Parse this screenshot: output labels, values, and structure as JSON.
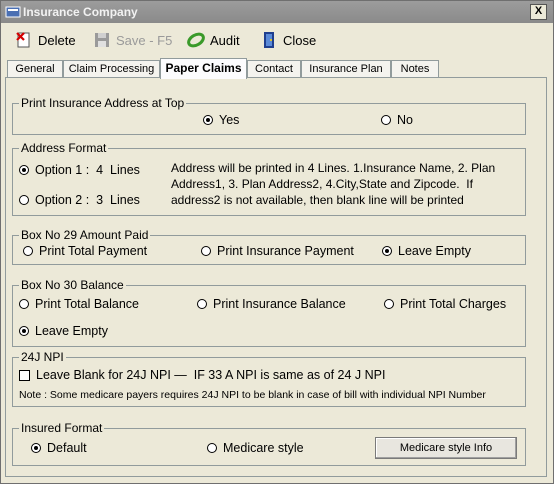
{
  "window": {
    "title": "Insurance Company",
    "close_glyph": "X"
  },
  "toolbar": {
    "delete_label": "Delete",
    "save_label": "Save - F5",
    "audit_label": "Audit",
    "close_label": "Close"
  },
  "tabs": [
    {
      "label": "General"
    },
    {
      "label": "Claim Processing"
    },
    {
      "label": "Paper Claims"
    },
    {
      "label": "Contact"
    },
    {
      "label": "Insurance Plan"
    },
    {
      "label": "Notes"
    }
  ],
  "print_address": {
    "title": "Print Insurance Address at Top",
    "yes": "Yes",
    "no": "No"
  },
  "address_format": {
    "title": "Address Format",
    "option1": "Option 1 :  4  Lines",
    "option2": "Option 2 :  3  Lines",
    "description_line1": "Address will be printed in 4 Lines. 1.Insurance Name, 2. Plan",
    "description_line2": "Address1, 3. Plan Address2, 4.City,State and Zipcode.  If",
    "description_line3": "address2 is not available, then blank line will be printed"
  },
  "box29": {
    "title": "Box No 29 Amount Paid",
    "total": "Print Total Payment",
    "insurance": "Print Insurance Payment",
    "empty": "Leave Empty"
  },
  "box30": {
    "title": "Box No 30 Balance",
    "total": "Print Total Balance",
    "insurance": "Print Insurance Balance",
    "charges": "Print Total Charges",
    "empty": "Leave Empty"
  },
  "npi": {
    "title": "24J NPI",
    "checkbox_label": "Leave Blank for 24J NPI —  IF 33 A NPI is same as of 24 J NPI",
    "note": "Note : Some medicare payers requires 24J NPI to be blank in case of bill with individual NPI Number"
  },
  "insured_format": {
    "title": "Insured Format",
    "default": "Default",
    "medicare": "Medicare style",
    "info_button": "Medicare style Info"
  }
}
